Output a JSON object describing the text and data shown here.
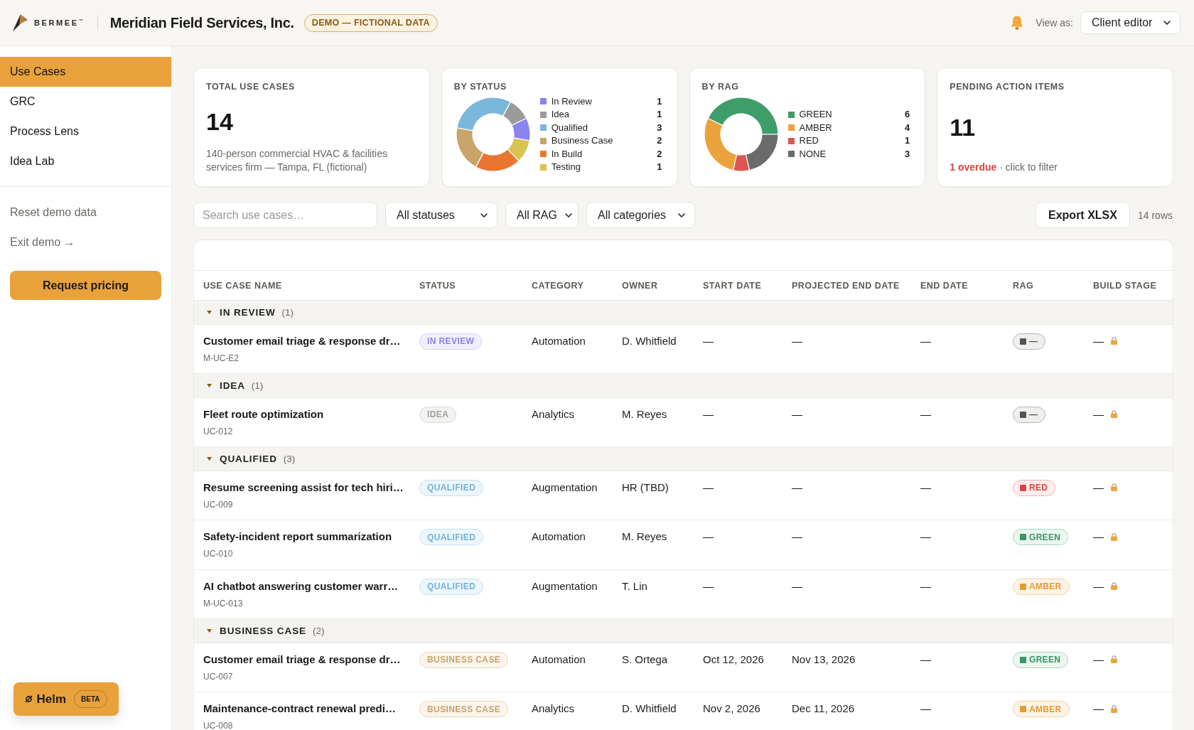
{
  "header": {
    "brand": "BERMEE$^{™}$",
    "company": "Meridian Field Services, Inc.",
    "badge": "DEMO — FICTIONAL DATA",
    "view_as": {
      "label": "View as:",
      "value": "Client editor"
    }
  },
  "sidebar": {
    "items": [
      {
        "label": "Use Cases",
        "selected": true
      },
      {
        "label": "GRC",
        "selected": false
      },
      {
        "label": "Process Lens",
        "selected": false
      },
      {
        "label": "Idea Lab",
        "selected": false
      }
    ],
    "links": [
      "Reset demo data",
      "Exit demo →"
    ],
    "cta": "Request pricing",
    "helm": {
      "label": "Helm",
      "badge": "BETA"
    }
  },
  "summary": {
    "total": {
      "title": "TOTAL USE CASES",
      "value": "14",
      "description": "140-person commercial HVAC & facilities services firm — Tampa, FL (fictional)"
    },
    "by_status": {
      "title": "BY STATUS",
      "chart_data": {
        "type": "donut",
        "categories": [
          "In Review",
          "Idea",
          "Qualified",
          "Business Case",
          "In Build",
          "Testing"
        ],
        "values": [
          10,
          10,
          30,
          20,
          20,
          10
        ]
      },
      "legend": [
        {
          "count": "1",
          "color": "#8b83f0"
        },
        {
          "count": "1",
          "color": "#9b9b9b"
        },
        {
          "count": "3",
          "color": "#7ab8db"
        },
        {
          "count": "2",
          "color": "#c9a46b"
        },
        {
          "count": "2",
          "color": "#e8762f"
        },
        {
          "count": "1",
          "color": "#d9c351"
        }
      ]
    },
    "by_rag": {
      "title": "BY RAG",
      "chart_data": {
        "type": "donut",
        "categories": [
          "GREEN",
          "AMBER",
          "RED",
          "NONE"
        ],
        "values": [
          42.9,
          28.6,
          7.1,
          21.4
        ]
      },
      "legend": [
        {
          "count": "6",
          "color": "#3f9d6a"
        },
        {
          "count": "4",
          "color": "#eaa23c"
        },
        {
          "count": "1",
          "color": "#dc5652"
        },
        {
          "count": "3",
          "color": "#6b6b6b"
        }
      ]
    },
    "pending": {
      "title": "PENDING ACTION ITEMS",
      "value": "11",
      "note": "**1 overdue** · click to filter"
    }
  },
  "filters": {
    "search": {
      "placeholder": "Search use cases…"
    },
    "selects": [
      {
        "value": "All statuses"
      },
      {
        "value": "All RAG"
      },
      {
        "value": "All categories"
      }
    ],
    "export": "Export XLSX",
    "row_count": "14 rows"
  },
  "table": {
    "columns": [
      "USE CASE NAME",
      "STATUS",
      "CATEGORY",
      "OWNER",
      "START DATE",
      "PROJECTED END DATE",
      "END DATE",
      "RAG",
      "BUILD STAGE"
    ],
    "groups": [
      {
        "label": "IN REVIEW",
        "count": "(1)",
        "expanded": true,
        "rows": [
          {
            "name": "Customer email triage & response dr…",
            "id": "M-UC-E2",
            "status": {
              "label": "IN REVIEW",
              "kind": "in_review"
            },
            "category": "Automation",
            "owner": "D. Whitfield",
            "start_date": "—",
            "projected_end_date": "—",
            "end_date": "—",
            "rag": {
              "label": "—",
              "kind": "none"
            },
            "build_stage": "—",
            "locked": true
          }
        ]
      },
      {
        "label": "IDEA",
        "count": "(1)",
        "expanded": true,
        "rows": [
          {
            "name": "Fleet route optimization",
            "id": "UC-012",
            "status": {
              "label": "IDEA",
              "kind": "idea"
            },
            "category": "Analytics",
            "owner": "M. Reyes",
            "start_date": "—",
            "projected_end_date": "—",
            "end_date": "—",
            "rag": {
              "label": "—",
              "kind": "none"
            },
            "build_stage": "—",
            "locked": true
          }
        ]
      },
      {
        "label": "QUALIFIED",
        "count": "(3)",
        "expanded": true,
        "rows": [
          {
            "name": "Resume screening assist for tech hiri…",
            "id": "UC-009",
            "status": {
              "label": "QUALIFIED",
              "kind": "qualified"
            },
            "category": "Augmentation",
            "owner": "HR (TBD)",
            "start_date": "—",
            "projected_end_date": "—",
            "end_date": "—",
            "rag": {
              "label": "RED",
              "kind": "red"
            },
            "build_stage": "—",
            "locked": true
          },
          {
            "name": "Safety-incident report summarization",
            "id": "UC-010",
            "status": {
              "label": "QUALIFIED",
              "kind": "qualified"
            },
            "category": "Automation",
            "owner": "M. Reyes",
            "start_date": "—",
            "projected_end_date": "—",
            "end_date": "—",
            "rag": {
              "label": "GREEN",
              "kind": "green"
            },
            "build_stage": "—",
            "locked": true
          },
          {
            "name": "AI chatbot answering customer warr…",
            "id": "M-UC-013",
            "status": {
              "label": "QUALIFIED",
              "kind": "qualified"
            },
            "category": "Augmentation",
            "owner": "T. Lin",
            "start_date": "—",
            "projected_end_date": "—",
            "end_date": "—",
            "rag": {
              "label": "AMBER",
              "kind": "amber"
            },
            "build_stage": "—",
            "locked": true
          }
        ]
      },
      {
        "label": "BUSINESS CASE",
        "count": "(2)",
        "expanded": true,
        "rows": [
          {
            "name": "Customer email triage & response dr…",
            "id": "UC-007",
            "status": {
              "label": "BUSINESS CASE",
              "kind": "business_case"
            },
            "category": "Automation",
            "owner": "S. Ortega",
            "start_date": "Oct 12, 2026",
            "projected_end_date": "Nov 13, 2026",
            "end_date": "—",
            "rag": {
              "label": "GREEN",
              "kind": "green"
            },
            "build_stage": "—",
            "locked": true
          },
          {
            "name": "Maintenance-contract renewal predi…",
            "id": "UC-008",
            "status": {
              "label": "BUSINESS CASE",
              "kind": "business_case"
            },
            "category": "Analytics",
            "owner": "D. Whitfield",
            "start_date": "Nov 2, 2026",
            "projected_end_date": "Dec 11, 2026",
            "end_date": "—",
            "rag": {
              "label": "AMBER",
              "kind": "amber"
            },
            "build_stage": "—",
            "locked": true
          }
        ]
      }
    ]
  }
}
